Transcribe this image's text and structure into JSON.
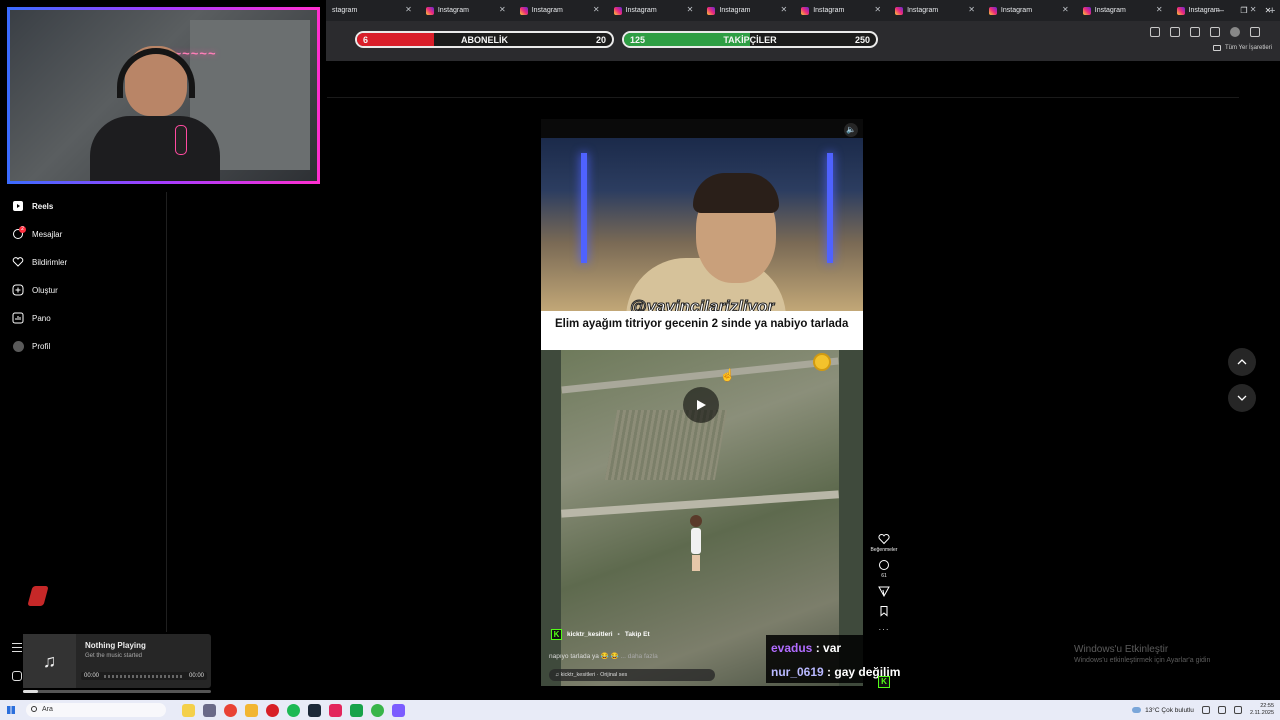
{
  "browser": {
    "tabs": [
      {
        "label": "stagram"
      },
      {
        "label": "Instagram"
      },
      {
        "label": "Instagram"
      },
      {
        "label": "Instagram"
      },
      {
        "label": "Instagram"
      },
      {
        "label": "Instagram"
      },
      {
        "label": "Instagram"
      },
      {
        "label": "Instagram"
      },
      {
        "label": "Instagram"
      },
      {
        "label": "Instagram"
      }
    ],
    "new_tab": "+",
    "bookmarks_label": "Tüm Yer İşaretleri"
  },
  "overlay": {
    "subscribers": {
      "label": "ABONELİK",
      "current": "6",
      "goal": "20",
      "progress": 0.3
    },
    "followers": {
      "label": "TAKİPÇİLER",
      "current": "125",
      "goal": "250",
      "progress": 0.5
    }
  },
  "sidebar": {
    "items": [
      {
        "label": "Reels",
        "icon": "reels-icon"
      },
      {
        "label": "Mesajlar",
        "icon": "messages-icon",
        "badge": "2"
      },
      {
        "label": "Bildirimler",
        "icon": "heart-icon"
      },
      {
        "label": "Oluştur",
        "icon": "plus-square-icon"
      },
      {
        "label": "Pano",
        "icon": "dashboard-icon"
      },
      {
        "label": "Profil",
        "icon": "profile-avatar"
      }
    ]
  },
  "music_widget": {
    "title": "Nothing Playing",
    "subtitle": "Get the music started",
    "time_start": "00:00",
    "time_end": "00:00",
    "icon": "♫"
  },
  "reel": {
    "handle": "@yayincilarizliyor",
    "caption": "Elim ayağım titriyor gecenin 2 sinde ya nabiyo tarlada",
    "author": "kicktr_kesitleri",
    "follow": "Takip Et",
    "description": "napıyo tarlada ya 😂 😂",
    "more": "... daha fazla",
    "audio": "♫ kicktr_kesitleri · Orijinal ses",
    "likes_label": "Beğenmeler",
    "comments_count": "61",
    "more_dots": "···"
  },
  "chat": [
    {
      "user": "evadus",
      "sep": " : ",
      "message": "var"
    },
    {
      "user": "nur_0619",
      "sep": " : ",
      "message": "gay değilim"
    }
  ],
  "watermark": {
    "title": "Windows'u Etkinleştir",
    "subtitle": "Windows'u etkinleştirmek için Ayarlar'a gidin"
  },
  "taskbar": {
    "search_placeholder": "Ara",
    "weather": "13°C  Çok bulutlu",
    "time": "22:55",
    "date": "2.11.2025"
  },
  "colors": {
    "subscriber_fill": "#d91e2a",
    "follower_fill": "#2e9e44",
    "chat_user_1": "#b16cff",
    "chat_user_2": "#b9b9ff",
    "kick_green": "#53fc18"
  }
}
